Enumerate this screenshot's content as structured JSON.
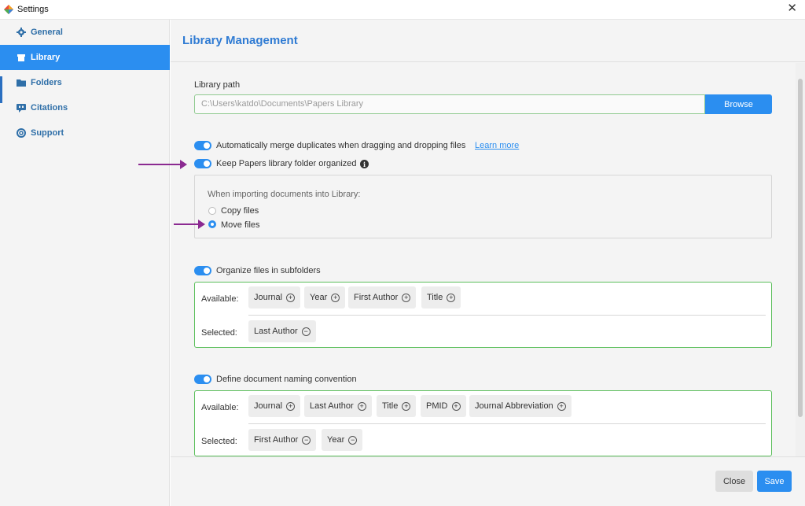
{
  "window": {
    "title": "Settings"
  },
  "sidebar": {
    "items": [
      {
        "label": "General",
        "icon": "gear-icon",
        "active": false
      },
      {
        "label": "Library",
        "icon": "library-icon",
        "active": true
      },
      {
        "label": "Folders",
        "icon": "folder-icon",
        "active": false
      },
      {
        "label": "Citations",
        "icon": "quote-icon",
        "active": false
      },
      {
        "label": "Support",
        "icon": "lifebuoy-icon",
        "active": false
      }
    ]
  },
  "main": {
    "title": "Library Management",
    "library_path": {
      "label": "Library path",
      "value": "C:\\Users\\katdo\\Documents\\Papers Library",
      "browse_label": "Browse"
    },
    "merge_duplicates": {
      "label": "Automatically merge duplicates when dragging and dropping files",
      "link": "Learn more",
      "enabled": true
    },
    "keep_organized": {
      "label": "Keep Papers library folder organized",
      "enabled": true
    },
    "import": {
      "prompt": "When importing documents into Library:",
      "options": [
        {
          "label": "Copy files",
          "checked": false
        },
        {
          "label": "Move files",
          "checked": true
        }
      ]
    },
    "subfolders": {
      "label": "Organize files in subfolders",
      "enabled": true,
      "available_label": "Available:",
      "selected_label": "Selected:",
      "available": [
        "Journal",
        "Year",
        "First Author",
        "Title"
      ],
      "selected": [
        "Last Author"
      ]
    },
    "naming": {
      "label": "Define document naming convention",
      "enabled": true,
      "available_label": "Available:",
      "selected_label": "Selected:",
      "available": [
        "Journal",
        "Last Author",
        "Title",
        "PMID",
        "Journal Abbreviation"
      ],
      "selected": [
        "First Author",
        "Year"
      ]
    }
  },
  "footer": {
    "close_label": "Close",
    "save_label": "Save"
  },
  "colors": {
    "accent": "#2b8ef0",
    "title": "#2f7bd3",
    "annotation_arrow": "#8b2a91",
    "box_border": "#5cbf5c"
  }
}
